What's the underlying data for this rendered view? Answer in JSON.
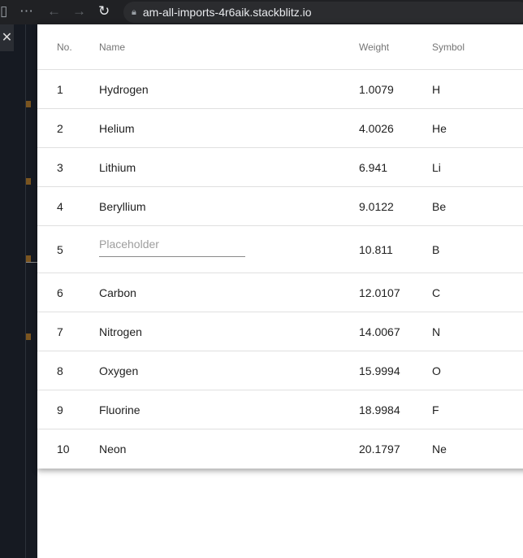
{
  "browser": {
    "url": "am-all-imports-4r6aik.stackblitz.io"
  },
  "table": {
    "headers": {
      "no": "No.",
      "name": "Name",
      "weight": "Weight",
      "symbol": "Symbol"
    },
    "rows": [
      {
        "no": "1",
        "name": "Hydrogen",
        "weight": "1.0079",
        "symbol": "H"
      },
      {
        "no": "2",
        "name": "Helium",
        "weight": "4.0026",
        "symbol": "He"
      },
      {
        "no": "3",
        "name": "Lithium",
        "weight": "6.941",
        "symbol": "Li"
      },
      {
        "no": "4",
        "name": "Beryllium",
        "weight": "9.0122",
        "symbol": "Be"
      },
      {
        "no": "5",
        "name": "",
        "placeholder": "Placeholder",
        "weight": "10.811",
        "symbol": "B"
      },
      {
        "no": "6",
        "name": "Carbon",
        "weight": "12.0107",
        "symbol": "C"
      },
      {
        "no": "7",
        "name": "Nitrogen",
        "weight": "14.0067",
        "symbol": "N"
      },
      {
        "no": "8",
        "name": "Oxygen",
        "weight": "15.9994",
        "symbol": "O"
      },
      {
        "no": "9",
        "name": "Fluorine",
        "weight": "18.9984",
        "symbol": "F"
      },
      {
        "no": "10",
        "name": "Neon",
        "weight": "20.1797",
        "symbol": "Ne"
      }
    ]
  }
}
